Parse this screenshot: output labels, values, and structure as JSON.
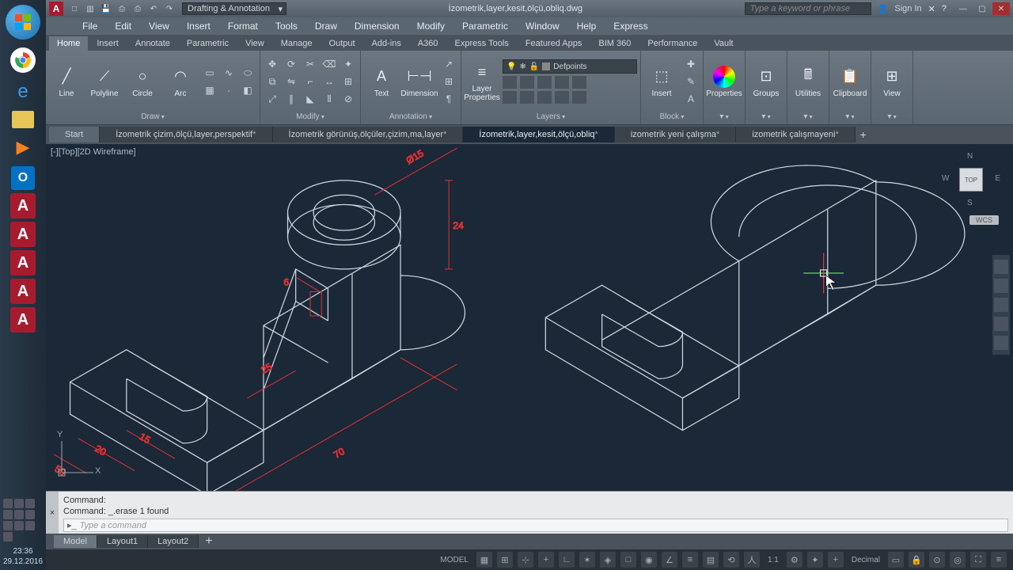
{
  "title": {
    "workspace": "Drafting & Annotation",
    "document": "İzometrik,layer,kesit,ölçü,obliq.dwg",
    "search_placeholder": "Type a keyword or phrase",
    "signin": "Sign In"
  },
  "menu": [
    "File",
    "Edit",
    "View",
    "Insert",
    "Format",
    "Tools",
    "Draw",
    "Dimension",
    "Modify",
    "Parametric",
    "Window",
    "Help",
    "Express"
  ],
  "ribbon_tabs": [
    "Home",
    "Insert",
    "Annotate",
    "Parametric",
    "View",
    "Manage",
    "Output",
    "Add-ins",
    "A360",
    "Express Tools",
    "Featured Apps",
    "BIM 360",
    "Performance",
    "Vault"
  ],
  "ribbon": {
    "draw": {
      "title": "Draw",
      "line": "Line",
      "polyline": "Polyline",
      "circle": "Circle",
      "arc": "Arc"
    },
    "modify": {
      "title": "Modify"
    },
    "annotation": {
      "title": "Annotation",
      "text": "Text",
      "dimension": "Dimension"
    },
    "layers": {
      "title": "Layers",
      "properties": "Layer\nProperties",
      "current": "Defpoints"
    },
    "block": {
      "title": "Block",
      "insert": "Insert"
    },
    "properties": {
      "title": "Properties"
    },
    "groups": {
      "title": "Groups"
    },
    "utilities": {
      "title": "Utilities"
    },
    "clipboard": {
      "title": "Clipboard"
    },
    "view": {
      "title": "View"
    }
  },
  "file_tabs": [
    {
      "label": "Start",
      "active": false,
      "start": true
    },
    {
      "label": "İzometrik çizim,ölçü,layer,perspektif",
      "dirty": true
    },
    {
      "label": "İzometrik görünüş,ölçüler,çizim,ma,layer",
      "dirty": true
    },
    {
      "label": "İzometrik,layer,kesit,ölçü,obliq",
      "dirty": true,
      "active": true
    },
    {
      "label": "izometrik yeni çalışma",
      "dirty": true
    },
    {
      "label": "izometrik çalışmayeni",
      "dirty": true
    }
  ],
  "viewport": {
    "label": "[-][Top][2D Wireframe]",
    "viewcube": {
      "n": "N",
      "s": "S",
      "e": "E",
      "w": "W",
      "face": "TOP"
    },
    "wcs": "WCS",
    "ucs": {
      "x": "X",
      "y": "Y"
    },
    "dimensions": {
      "d1": "Ø15",
      "d2": "24",
      "d3": "6",
      "d4": "25",
      "d5": "15",
      "d6": "20",
      "d7": "50",
      "d8": "70"
    }
  },
  "cmdline": {
    "hist1": "Command:",
    "hist2": "Command: _.erase 1 found",
    "placeholder": "Type a command"
  },
  "layout_tabs": [
    "Model",
    "Layout1",
    "Layout2"
  ],
  "status": {
    "model": "MODEL",
    "scale": "1:1",
    "units": "Decimal"
  },
  "taskbar": {
    "time": "23:36",
    "date": "29.12.2016"
  }
}
